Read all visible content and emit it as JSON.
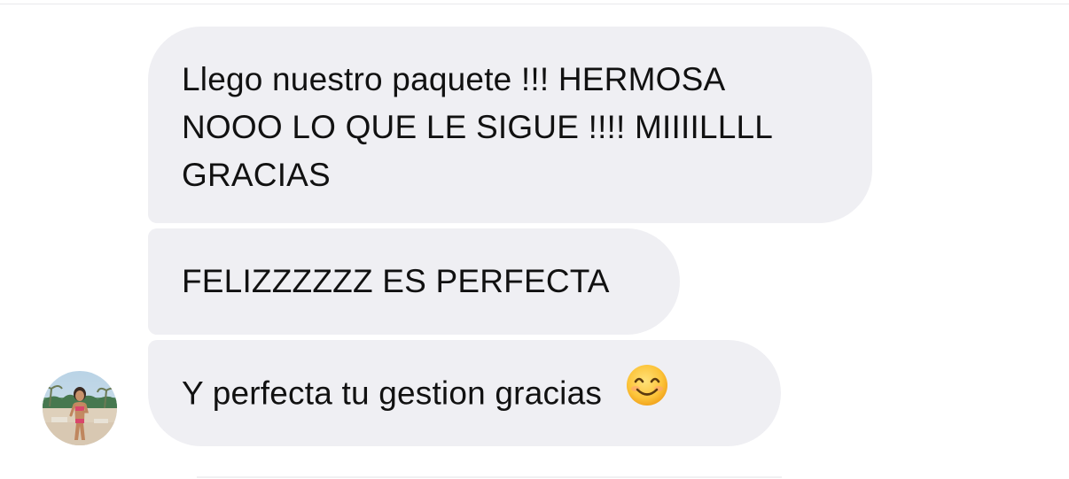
{
  "conversation": {
    "messages": [
      {
        "text": "Llego nuestro paquete !!! HERMOSA\nNOOO LO QUE LE SIGUE !!!! MIIIILLLL\nGRACIAS"
      },
      {
        "text": "FELIZZZZZZ ES PERFECTA"
      },
      {
        "text": "Y perfecta tu gestion gracias",
        "emoji": "smiling-face-icon"
      }
    ]
  },
  "sender": {
    "avatar_icon": "beach-photo-avatar"
  },
  "colors": {
    "bubble_background": "#efeff3",
    "text": "#111111",
    "page_background": "#ffffff"
  }
}
